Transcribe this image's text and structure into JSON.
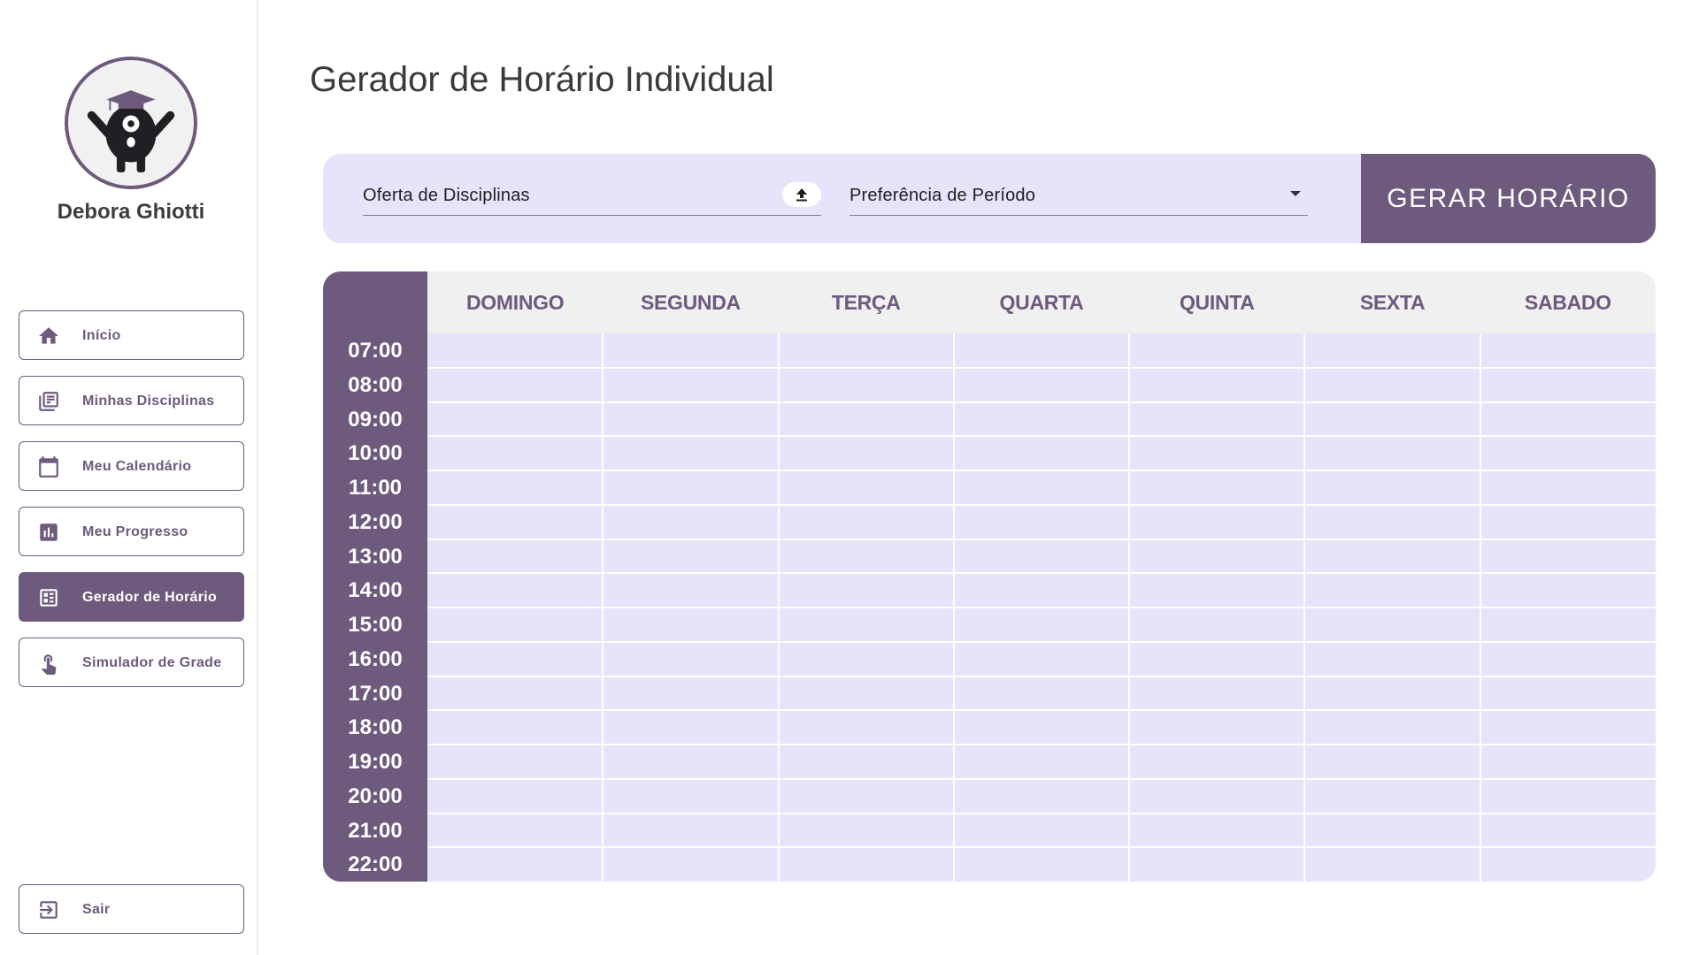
{
  "user": {
    "name": "Debora Ghiotti",
    "avatar": "graduation-mascot"
  },
  "nav": {
    "items": [
      {
        "id": "inicio",
        "label": "Início",
        "icon": "home-icon",
        "active": false
      },
      {
        "id": "minhas-disciplinas",
        "label": "Minhas Disciplinas",
        "icon": "library-books-icon",
        "active": false
      },
      {
        "id": "meu-calendario",
        "label": "Meu Calendário",
        "icon": "calendar-icon",
        "active": false
      },
      {
        "id": "meu-progresso",
        "label": "Meu Progresso",
        "icon": "bar-chart-icon",
        "active": false
      },
      {
        "id": "gerador-de-horario",
        "label": "Gerador de Horário",
        "icon": "dashboard-icon",
        "active": true
      },
      {
        "id": "simulador-de-grade",
        "label": "Simulador de Grade",
        "icon": "touch-icon",
        "active": false
      }
    ],
    "logout": {
      "label": "Sair",
      "icon": "logout-icon"
    }
  },
  "page": {
    "title": "Gerador de Horário Individual"
  },
  "form": {
    "oferta_label": "Oferta de Disciplinas",
    "upload_icon": "upload-icon",
    "preferencia_label": "Preferência de Período",
    "generate_label": "GERAR HORÁRIO"
  },
  "schedule": {
    "days": [
      "DOMINGO",
      "SEGUNDA",
      "TERÇA",
      "QUARTA",
      "QUINTA",
      "SEXTA",
      "SABADO"
    ],
    "times": [
      "07:00",
      "08:00",
      "09:00",
      "10:00",
      "11:00",
      "12:00",
      "13:00",
      "14:00",
      "15:00",
      "16:00",
      "17:00",
      "18:00",
      "19:00",
      "20:00",
      "21:00",
      "22:00"
    ]
  },
  "colors": {
    "accent": "#6d5a7c",
    "panel": "#e5e4fa",
    "header_bg": "#f0f0f0"
  }
}
